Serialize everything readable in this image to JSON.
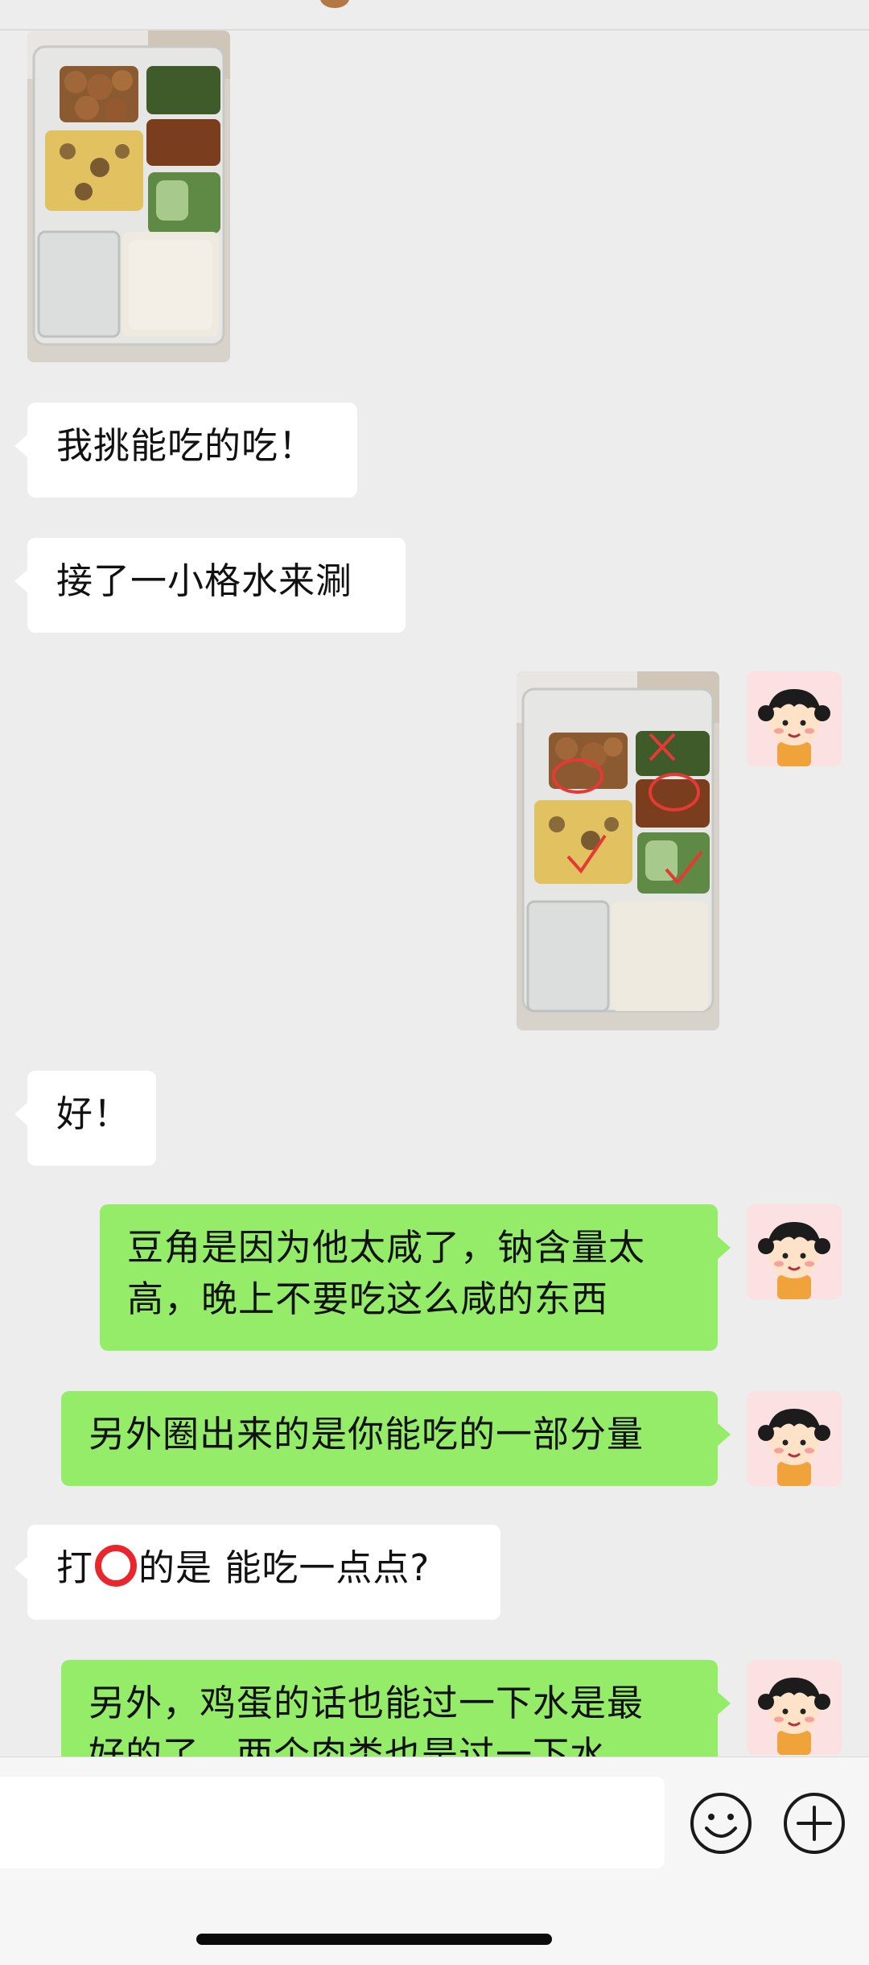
{
  "messages": [
    {
      "side": "left",
      "type": "image"
    },
    {
      "side": "left",
      "type": "text",
      "text": "我挑能吃的吃！"
    },
    {
      "side": "left",
      "type": "text",
      "text": "接了一小格水来涮"
    },
    {
      "side": "right",
      "type": "image"
    },
    {
      "side": "left",
      "type": "text",
      "text": "好！"
    },
    {
      "side": "right",
      "type": "text",
      "lines": [
        "豆角是因为他太咸了，钠含量太",
        "高，晚上不要吃这么咸的东西"
      ]
    },
    {
      "side": "right",
      "type": "text",
      "text": "另外圈出来的是你能吃的一部分量"
    },
    {
      "side": "left",
      "type": "text",
      "before_emoji": "打",
      "emoji": "red-circle",
      "after_emoji": "的是 能吃一点点?"
    },
    {
      "side": "right",
      "type": "text",
      "lines": [
        "另外，鸡蛋的话也能过一下水是最",
        "好的了，两个肉类也是过一下水"
      ]
    }
  ],
  "input": {
    "value": ""
  },
  "colors": {
    "background": "#ededed",
    "received_bubble": "#ffffff",
    "sent_bubble": "#95ec69",
    "emoji_circle": "#e8262b"
  },
  "icons": {
    "emoji_button": "smiley-icon",
    "more_button": "plus-circle-icon"
  }
}
